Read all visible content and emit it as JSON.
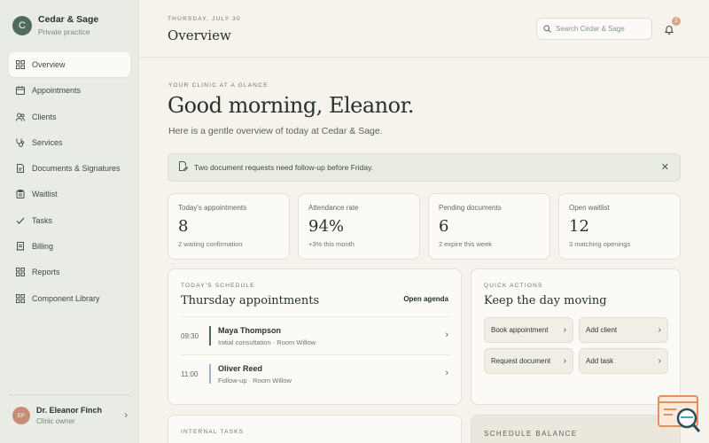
{
  "app": {
    "brand_initial": "C",
    "brand_name": "Cedar & Sage",
    "brand_sub": "Private practice"
  },
  "sidebar": {
    "items": [
      {
        "label": "Overview",
        "icon": "grid-icon"
      },
      {
        "label": "Appointments",
        "icon": "calendar-icon"
      },
      {
        "label": "Clients",
        "icon": "users-icon"
      },
      {
        "label": "Services",
        "icon": "stethoscope-icon"
      },
      {
        "label": "Documents & Signatures",
        "icon": "document-icon"
      },
      {
        "label": "Waitlist",
        "icon": "clipboard-icon"
      },
      {
        "label": "Tasks",
        "icon": "check-icon"
      },
      {
        "label": "Billing",
        "icon": "receipt-icon"
      },
      {
        "label": "Reports",
        "icon": "grid-icon"
      },
      {
        "label": "Component Library",
        "icon": "grid-icon"
      }
    ],
    "user": {
      "initials": "EF",
      "name": "Dr. Eleanor Finch",
      "role": "Clinic owner"
    }
  },
  "header": {
    "date": "THURSDAY, JULY 30",
    "title": "Overview",
    "search_placeholder": "Search Cedar & Sage",
    "notification_count": "2"
  },
  "main": {
    "eyebrow": "YOUR CLINIC AT A GLANCE",
    "greeting": "Good morning, Eleanor.",
    "intro": "Here is a gentle overview of today at Cedar & Sage.",
    "alert": "Two document requests need follow-up before Friday.",
    "stats": [
      {
        "label": "Today's appointments",
        "value": "8",
        "sub": "2 waiting confirmation"
      },
      {
        "label": "Attendance rate",
        "value": "94%",
        "sub": "+3% this month"
      },
      {
        "label": "Pending documents",
        "value": "6",
        "sub": "2 expire this week"
      },
      {
        "label": "Open waitlist",
        "value": "12",
        "sub": "3 matching openings"
      }
    ],
    "schedule": {
      "eyebrow": "TODAY'S SCHEDULE",
      "title": "Thursday appointments",
      "action": "Open agenda",
      "appointments": [
        {
          "time": "09:30",
          "name": "Maya Thompson",
          "detail": "Initial consultation · Room Willow",
          "accent": "#4f6b5c"
        },
        {
          "time": "11:00",
          "name": "Oliver Reed",
          "detail": "Follow-up · Room Willow",
          "accent": "#a6afc4"
        }
      ]
    },
    "quick_actions": {
      "eyebrow": "QUICK ACTIONS",
      "title": "Keep the day moving",
      "items": [
        "Book appointment",
        "Add client",
        "Request document",
        "Add task"
      ]
    },
    "tasks": {
      "eyebrow": "INTERNAL TASKS"
    },
    "balance": {
      "title": "SCHEDULE BALANCE"
    }
  },
  "colors": {
    "accent": "#4f6b5c",
    "background": "#f6f3ec",
    "sidebar": "#e8ece4",
    "badge": "#d8a48b"
  }
}
